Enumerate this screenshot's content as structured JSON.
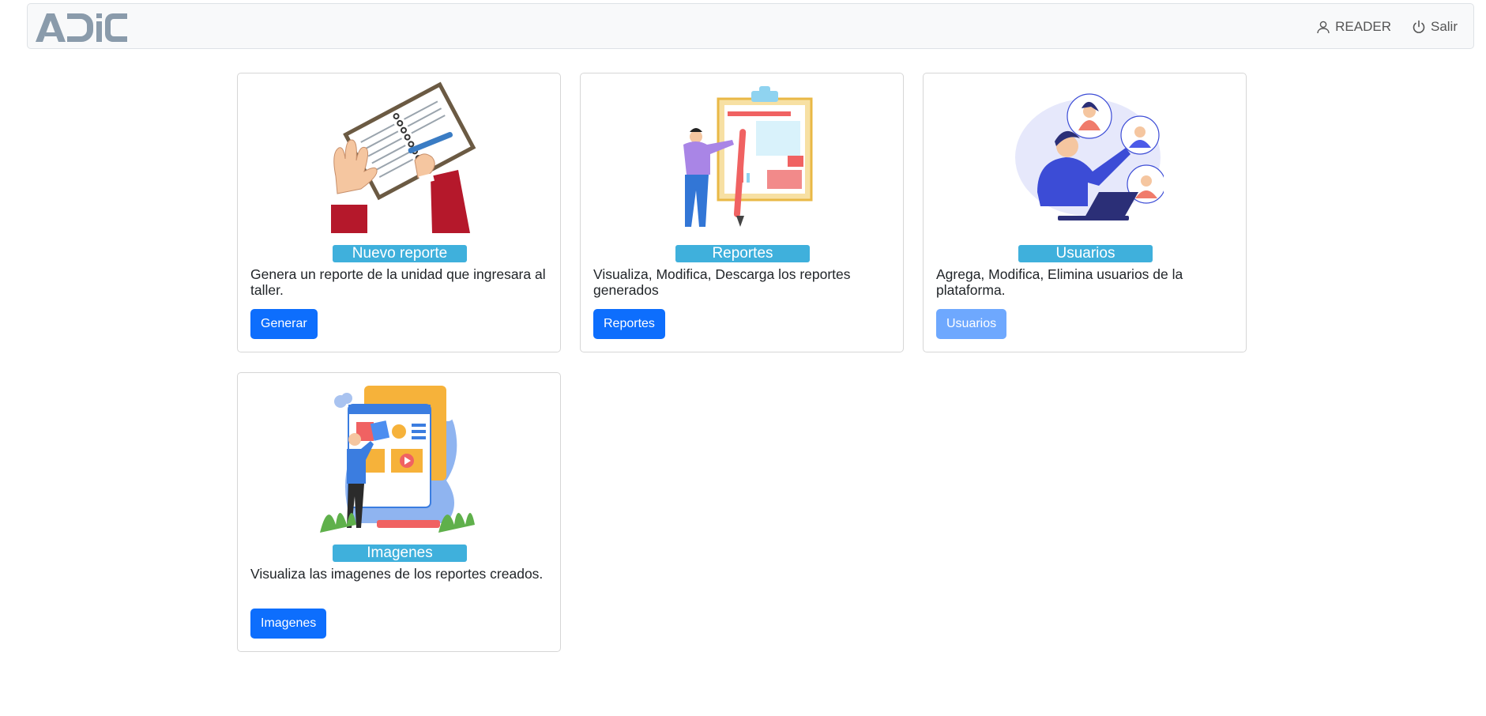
{
  "header": {
    "logo_text": "ADIC",
    "user_label": "READER",
    "logout_label": "Salir"
  },
  "cards": [
    {
      "title": "Nuevo reporte",
      "description": "Genera un reporte de la unidad que ingresara al taller.",
      "button": "Generar"
    },
    {
      "title": "Reportes",
      "description": "Visualiza, Modifica, Descarga los reportes generados",
      "button": "Reportes"
    },
    {
      "title": "Usuarios",
      "description": "Agrega, Modifica, Elimina usuarios de la plataforma.",
      "button": "Usuarios",
      "button_state": "disabled"
    },
    {
      "title": "Imagenes",
      "description": "Visualiza las imagenes de los reportes creados.",
      "button": "Imagenes"
    }
  ],
  "icons": [
    "user-icon",
    "power-icon"
  ],
  "colors": {
    "primary_button": "#0d6efd",
    "disabled_button": "#6ea8fe",
    "title_badge": "#3fb0dc",
    "navbar_bg": "#f8f9fa",
    "logo": "#8a9bab"
  }
}
